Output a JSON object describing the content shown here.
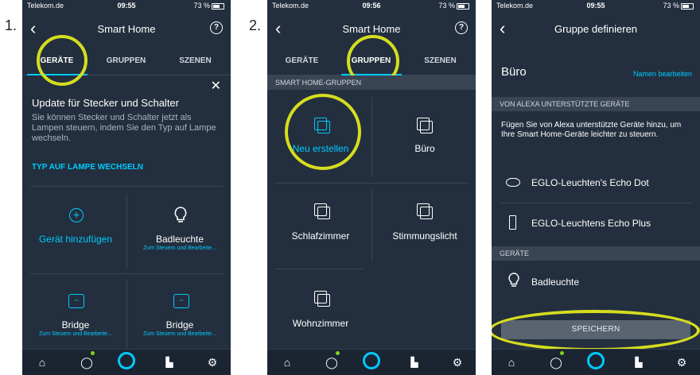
{
  "step_labels": [
    "1.",
    "2."
  ],
  "status": {
    "carrier": "Telekom.de",
    "battery": "73 %"
  },
  "phone1": {
    "time": "09:55",
    "title": "Smart Home",
    "tabs": [
      "GERÄTE",
      "GRUPPEN",
      "SZENEN"
    ],
    "active_tab": 0,
    "update_title": "Update für Stecker und Schalter",
    "update_body": "Sie können Stecker und Schalter jetzt als Lampen steuern, indem Sie den Typ auf Lampe wechseln.",
    "update_link": "TYP AUF LAMPE WECHSELN",
    "devices": [
      {
        "label": "Gerät hinzufügen",
        "sub": "",
        "icon": "plus-circle-icon",
        "accent": true
      },
      {
        "label": "Badleuchte",
        "sub": "Zum Steuern und Bearbeite...",
        "icon": "bulb-icon",
        "accent": false
      },
      {
        "label": "Bridge",
        "sub": "Zum Steuern und Bearbeite...",
        "icon": "bridge-icon",
        "accent": false
      },
      {
        "label": "Bridge",
        "sub": "Zum Steuern und Bearbeite...",
        "icon": "bridge-icon",
        "accent": false
      }
    ]
  },
  "phone2": {
    "time": "09:56",
    "title": "Smart Home",
    "tabs": [
      "GERÄTE",
      "GRUPPEN",
      "SZENEN"
    ],
    "active_tab": 1,
    "section": "SMART HOME-GRUPPEN",
    "groups": [
      {
        "label": "Neu erstellen",
        "accent": true
      },
      {
        "label": "Büro",
        "accent": false
      },
      {
        "label": "Schlafzimmer",
        "accent": false
      },
      {
        "label": "Stimmungslicht",
        "accent": false
      },
      {
        "label": "Wohnzimmer",
        "accent": false
      }
    ]
  },
  "phone3": {
    "time": "09:55",
    "title": "Gruppe definieren",
    "group_name": "Büro",
    "rename_link": "Namen bearbeiten",
    "section_alexa": "VON ALEXA UNTERSTÜTZTE GERÄTE",
    "alexa_help": "Fügen Sie von Alexa unterstützte Geräte hinzu, um Ihre Smart Home-Geräte leichter zu steuern.",
    "alexa_devices": [
      "EGLO-Leuchten's Echo Dot",
      "EGLO-Leuchtens Echo Plus"
    ],
    "section_devices": "GERÄTE",
    "devices": [
      "Badleuchte"
    ],
    "save_label": "SPEICHERN"
  },
  "colors": {
    "bg": "#232f3e",
    "accent": "#00caff",
    "highlight": "#d6dd1f"
  },
  "nav_icons": [
    "home-icon",
    "chat-icon",
    "alexa-icon",
    "activity-icon",
    "settings-icon"
  ]
}
